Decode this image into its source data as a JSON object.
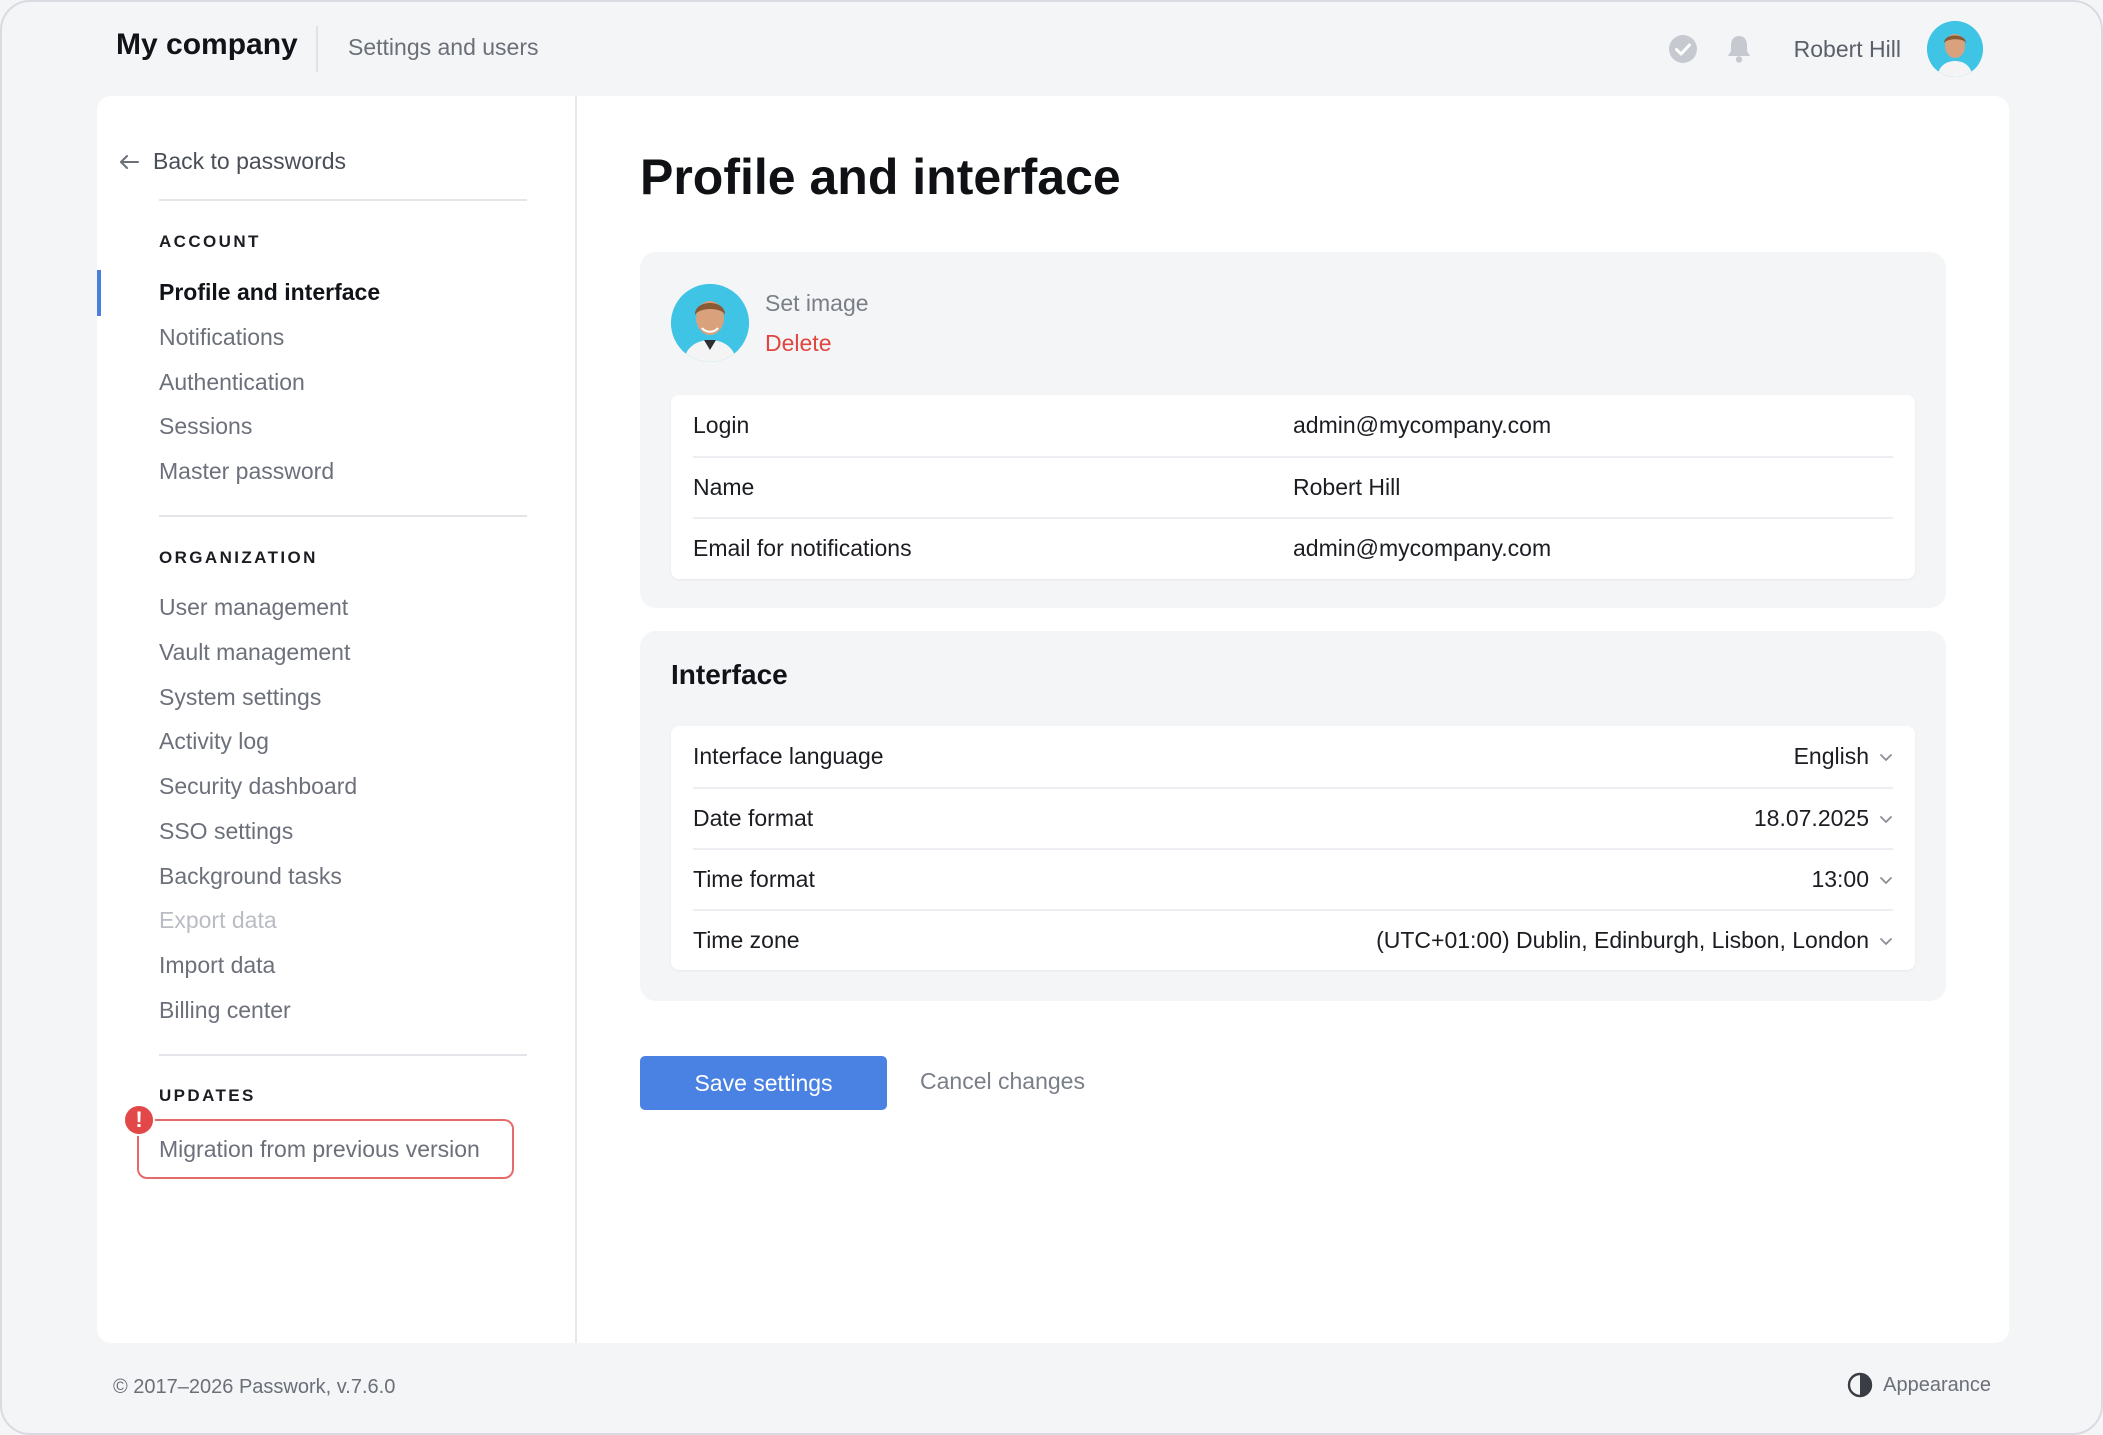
{
  "header": {
    "brand": "My company",
    "section": "Settings and users",
    "user_name": "Robert Hill",
    "icons": [
      "check-circle-icon",
      "bell-icon",
      "avatar"
    ]
  },
  "sidebar": {
    "back_label": "Back to passwords",
    "account_heading": "ACCOUNT",
    "account_items": [
      "Profile and interface",
      "Notifications",
      "Authentication",
      "Sessions",
      "Master password"
    ],
    "organization_heading": "ORGANIZATION",
    "organization_items": [
      "User management",
      "Vault management",
      "System settings",
      "Activity log",
      "Security dashboard",
      "SSO settings",
      "Background tasks",
      "Export data",
      "Import data",
      "Billing center"
    ],
    "updates_heading": "UPDATES",
    "migration_label": "Migration from previous version",
    "warning_glyph": "!"
  },
  "content": {
    "title": "Profile and interface",
    "profile": {
      "set_image": "Set image",
      "delete": "Delete",
      "rows": [
        {
          "label": "Login",
          "value": "admin@mycompany.com"
        },
        {
          "label": "Name",
          "value": "Robert Hill"
        },
        {
          "label": "Email for notifications",
          "value": "admin@mycompany.com"
        }
      ]
    },
    "interface": {
      "title": "Interface",
      "rows": [
        {
          "label": "Interface language",
          "value": "English"
        },
        {
          "label": "Date format",
          "value": "18.07.2025"
        },
        {
          "label": "Time format",
          "value": "13:00"
        },
        {
          "label": "Time zone",
          "value": "(UTC+01:00) Dublin, Edinburgh, Lisbon, London"
        }
      ]
    },
    "save_label": "Save settings",
    "cancel_label": "Cancel changes"
  },
  "footer": {
    "copyright": "© 2017–2026 Passwork, v.7.6.0",
    "appearance": "Appearance"
  },
  "colors": {
    "accent": "#4a82e3",
    "danger": "#e0463f",
    "active_bar": "#4a7fe0",
    "avatar_bg": "#3fc4e6"
  }
}
